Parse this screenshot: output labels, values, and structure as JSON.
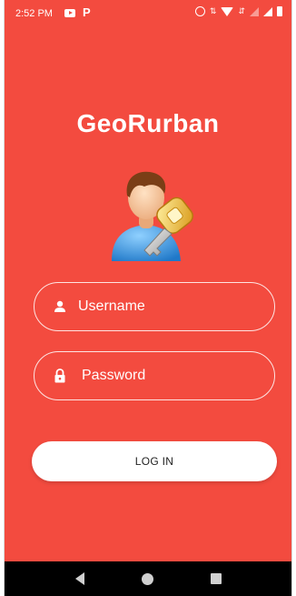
{
  "status_bar": {
    "time": "2:52 PM",
    "left_icons": [
      "youtube-icon",
      "p-icon"
    ],
    "right_icons": [
      "alarm-icon",
      "wifi-icon",
      "mobile-data-icon",
      "signal-icon",
      "battery-icon"
    ]
  },
  "app": {
    "title": "GeoRurban",
    "logo_icon": "user-key-icon"
  },
  "form": {
    "username": {
      "placeholder": "Username",
      "value": "",
      "icon": "person-icon"
    },
    "password": {
      "placeholder": "Password",
      "value": "",
      "icon": "lock-icon"
    },
    "login_label": "LOG IN"
  },
  "nav_bar": {
    "icons": [
      "back-icon",
      "home-icon",
      "recents-icon"
    ]
  },
  "colors": {
    "background": "#f34b3f",
    "button": "#ffffff",
    "navbar": "#000000"
  }
}
